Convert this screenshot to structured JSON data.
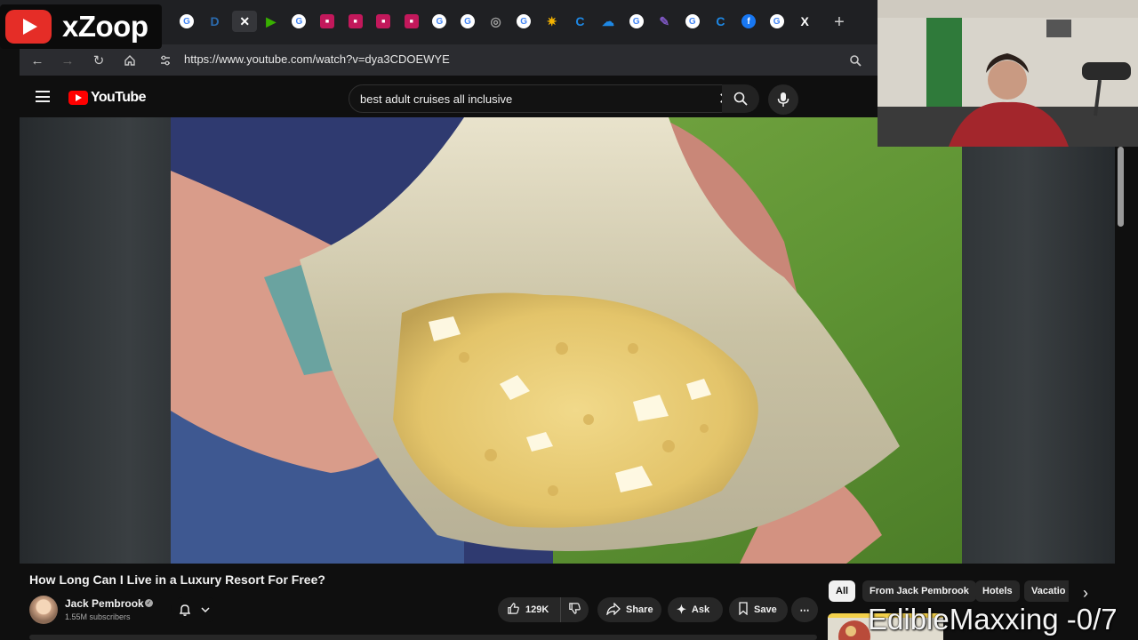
{
  "browser": {
    "url": "https://www.youtube.com/watch?v=dya3CDOEWYE",
    "new_tab_label": "+",
    "tabs": [
      {
        "icon": "google-icon",
        "color": "#4285f4"
      },
      {
        "icon": "generic-icon",
        "color": "#2b6cb0"
      },
      {
        "icon": "close-icon",
        "color": "#ffffff"
      },
      {
        "icon": "play-icon",
        "color": "#38b000"
      },
      {
        "icon": "google-icon",
        "color": "#4285f4"
      },
      {
        "icon": "video-icon",
        "color": "#c2185b"
      },
      {
        "icon": "video-icon",
        "color": "#c2185b"
      },
      {
        "icon": "video-icon",
        "color": "#c2185b"
      },
      {
        "icon": "video-icon",
        "color": "#c2185b"
      },
      {
        "icon": "google-icon",
        "color": "#4285f4"
      },
      {
        "icon": "google-icon",
        "color": "#4285f4"
      },
      {
        "icon": "chrome-icon",
        "color": "#9e9e9e"
      },
      {
        "icon": "google-icon",
        "color": "#4285f4"
      },
      {
        "icon": "spark-icon",
        "color": "#f5b301"
      },
      {
        "icon": "ring-icon",
        "color": "#1e88e5"
      },
      {
        "icon": "cloud-icon",
        "color": "#1e88e5"
      },
      {
        "icon": "google-icon",
        "color": "#4285f4"
      },
      {
        "icon": "paint-icon",
        "color": "#7e57c2"
      },
      {
        "icon": "google-icon",
        "color": "#4285f4"
      },
      {
        "icon": "ring-icon",
        "color": "#1e88e5"
      },
      {
        "icon": "facebook-icon",
        "color": "#1877f2"
      },
      {
        "icon": "google-icon",
        "color": "#4285f4"
      },
      {
        "icon": "x-icon",
        "color": "#ffffff"
      }
    ]
  },
  "logo": {
    "text": "xZoop"
  },
  "youtube": {
    "logo_text": "YouTube",
    "search_value": "best adult cruises all inclusive",
    "clear_label": "✕"
  },
  "video": {
    "title": "How Long Can I Live in a Luxury Resort For Free?",
    "channel": "Jack Pembrook",
    "subscribers": "1.55M subscribers",
    "likes": "129K",
    "share_label": "Share",
    "ask_label": "Ask",
    "save_label": "Save",
    "more_label": "⋯"
  },
  "chips": [
    "All",
    "From Jack Pembrook",
    "Hotels",
    "Vacatio"
  ],
  "overlay": {
    "text": "EdibleMaxxing -0/7"
  },
  "colors": {
    "accent": "#ff0000",
    "background": "#0f0f0f",
    "chip_bg": "#272727"
  }
}
